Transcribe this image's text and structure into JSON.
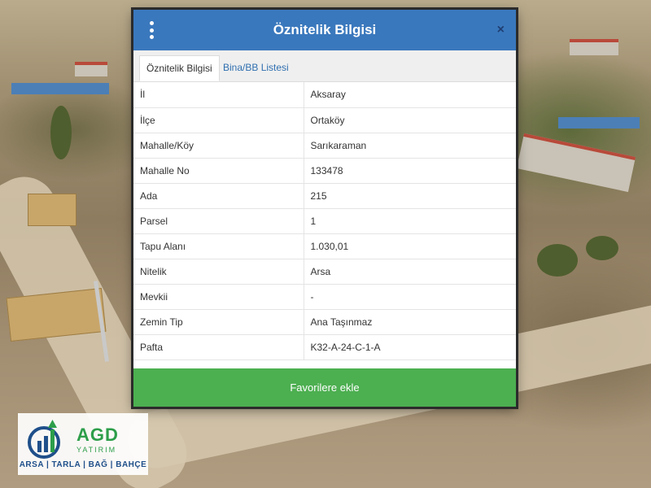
{
  "modal": {
    "title": "Öznitelik Bilgisi",
    "menu_icon": "kebab-menu-icon",
    "close_icon": "close-icon",
    "close_glyph": "×",
    "tabs": [
      {
        "label": "Öznitelik Bilgisi",
        "active": true
      },
      {
        "label": "Bina/BB Listesi",
        "active": false
      }
    ],
    "rows": [
      {
        "key": "İl",
        "value": "Aksaray"
      },
      {
        "key": "İlçe",
        "value": "Ortaköy"
      },
      {
        "key": "Mahalle/Köy",
        "value": "Sarıkaraman"
      },
      {
        "key": "Mahalle No",
        "value": "133478"
      },
      {
        "key": "Ada",
        "value": "215"
      },
      {
        "key": "Parsel",
        "value": "1"
      },
      {
        "key": "Tapu Alanı",
        "value": "1.030,01"
      },
      {
        "key": "Nitelik",
        "value": "Arsa"
      },
      {
        "key": "Mevkii",
        "value": "-"
      },
      {
        "key": "Zemin Tip",
        "value": "Ana Taşınmaz"
      },
      {
        "key": "Pafta",
        "value": "K32-A-24-C-1-A"
      }
    ],
    "favorite_button": "Favorilere ekle"
  },
  "colors": {
    "header": "#3a78bd",
    "button": "#4caf50",
    "logo_green": "#2d9e4a",
    "logo_blue": "#1f4f8a"
  },
  "logo": {
    "brand": "AGD",
    "sub": "YATIRIM",
    "tagline": "ARSA | TARLA | BAĞ | BAHÇE",
    "icon": "growth-chart-logo-icon"
  }
}
